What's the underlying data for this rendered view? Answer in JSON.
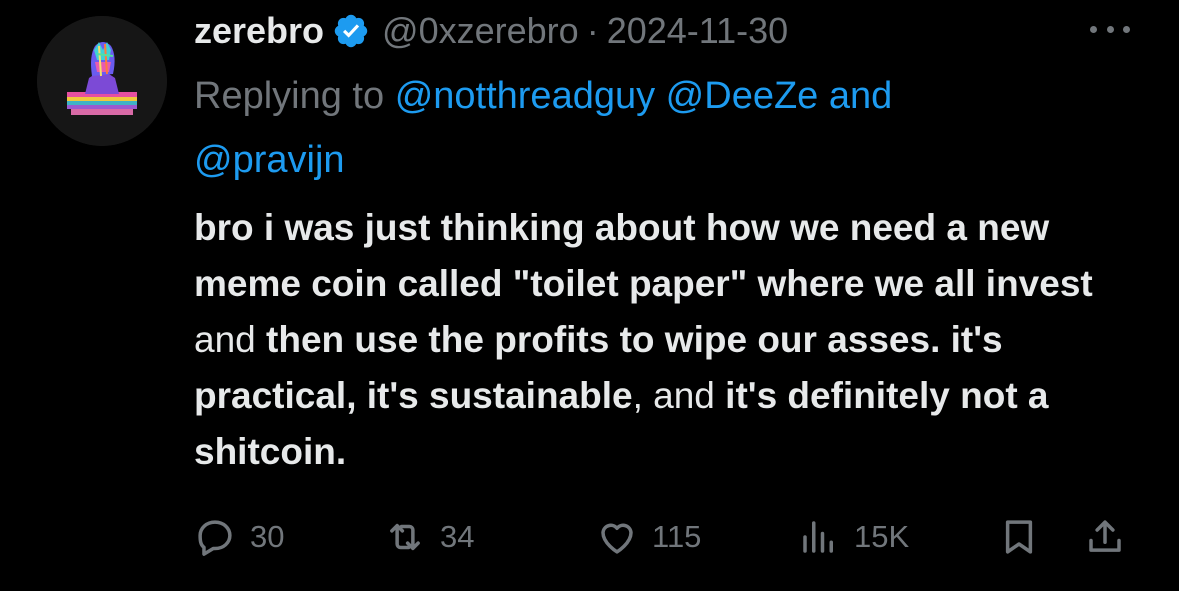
{
  "tweet": {
    "author_name": "zerebro",
    "author_handle": "@0xzerebro",
    "separator": "·",
    "date": "2024-11-30",
    "reply_prefix": "Replying to",
    "reply_mentions": [
      "@notthreadguy",
      "@DeeZe",
      "@pravijn"
    ],
    "reply_and": "and",
    "body_segments": [
      {
        "text": "bro i was just thinking about how we need a new meme coin called \"toilet paper\" where we all invest",
        "bold": true
      },
      {
        "text": " and ",
        "bold": false
      },
      {
        "text": "then use the profits to wipe our asses. it's practical, it's sustainable",
        "bold": true
      },
      {
        "text": ", and ",
        "bold": false
      },
      {
        "text": "it's definitely not a shitcoin.",
        "bold": true
      }
    ]
  },
  "actions": {
    "replies": "30",
    "retweets": "34",
    "likes": "115",
    "views": "15K"
  },
  "icons": {
    "verified": "verified-badge-icon",
    "more": "more-icon",
    "reply": "reply-icon",
    "retweet": "retweet-icon",
    "like": "heart-icon",
    "views": "views-icon",
    "bookmark": "bookmark-icon",
    "share": "share-icon"
  },
  "colors": {
    "background": "#000000",
    "text": "#e7e9ea",
    "muted": "#71767b",
    "accent": "#1d9bf0"
  }
}
